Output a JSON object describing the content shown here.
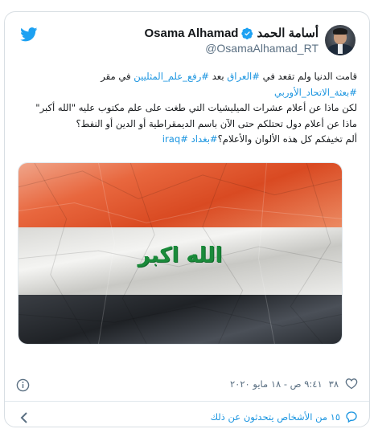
{
  "author": {
    "display_name_ar": "أسامة الحمد",
    "display_name_en": "Osama Alhamad",
    "handle": "@OsamaAlhamad_RT"
  },
  "tweet": {
    "line1_a": "قامت الدنيا ولم تقعد في ",
    "line1_tag1": "#العراق",
    "line1_b": " بعد ",
    "line1_tag2": "#رفع_علم_المثليين",
    "line1_c": " في مقر",
    "line2_tag": "#بعثة_الاتحاد_الأوربي",
    "line3": "لكن ماذا عن أعلام عشرات الميليشيات التي طغت على علم مكتوب عليه \"الله أكبر\"",
    "line4": "ماذا عن أعلام دول تحتلكم حتى الآن باسم الديمقراطية أو الدين أو النفط؟",
    "line5_a": "ألم تخيفكم كل هذه الألوان والأعلام؟",
    "line5_tag1": "#بغداد",
    "line5_sep": " ",
    "line5_tag2": "#iraq"
  },
  "image": {
    "flag_text": "الله اكبر",
    "colors": {
      "red": "#d94a22",
      "white": "#f4f4f2",
      "black": "#1f2226",
      "green": "#1a8a3a"
    }
  },
  "meta": {
    "likes": "٣٨",
    "timestamp": "٩:٤١ ص - ١٨ مايو ٢٠٢٠"
  },
  "footer": {
    "people_talking": "١٥ من الأشخاص يتحدثون عن ذلك"
  },
  "icons": [
    "twitter-bird-icon",
    "verified-icon",
    "heart-icon",
    "info-icon",
    "reply-icon",
    "chevron-left-icon"
  ],
  "colors": {
    "link": "#1b95e0",
    "muted": "#5b7083",
    "text": "#14171a"
  }
}
